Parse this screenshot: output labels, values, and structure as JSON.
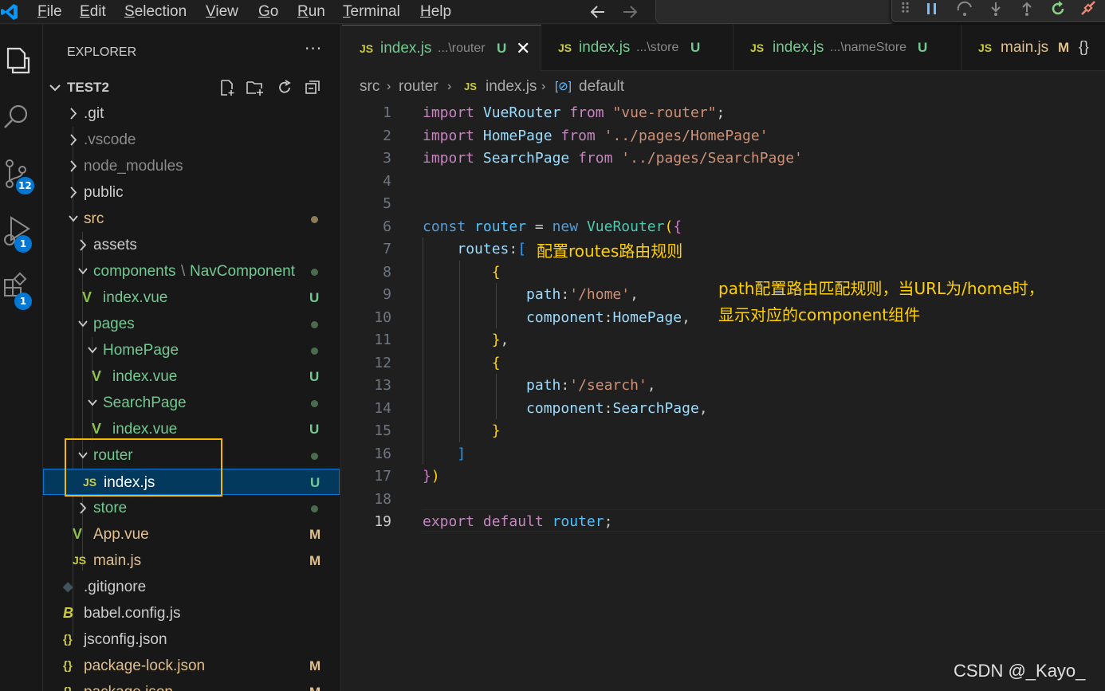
{
  "menubar": {
    "items": [
      "File",
      "Edit",
      "Selection",
      "View",
      "Go",
      "Run",
      "Terminal",
      "Help"
    ],
    "mnemonics": [
      "F",
      "E",
      "S",
      "V",
      "G",
      "R",
      "T",
      "H"
    ]
  },
  "activity_bar": {
    "source_control_badge": "12",
    "run_debug_badge": "1",
    "extensions_badge": "1"
  },
  "explorer": {
    "title": "EXPLORER",
    "more": "···",
    "workspace": "TEST2",
    "rows": [
      {
        "label": ".git",
        "status": ""
      },
      {
        "label": ".vscode",
        "status": ""
      },
      {
        "label": "node_modules",
        "status": ""
      },
      {
        "label": "public",
        "status": ""
      },
      {
        "label": "src",
        "status": "dot"
      },
      {
        "label": "assets",
        "status": ""
      },
      {
        "label": "components",
        "label2": "NavComponent",
        "status": "dot"
      },
      {
        "label": "index.vue",
        "status": "U"
      },
      {
        "label": "pages",
        "status": "dot"
      },
      {
        "label": "HomePage",
        "status": "dot"
      },
      {
        "label": "index.vue",
        "status": "U"
      },
      {
        "label": "SearchPage",
        "status": "dot"
      },
      {
        "label": "index.vue",
        "status": "U"
      },
      {
        "label": "router",
        "status": "dot"
      },
      {
        "label": "index.js",
        "status": "U"
      },
      {
        "label": "store",
        "status": "dot"
      },
      {
        "label": "App.vue",
        "status": "M"
      },
      {
        "label": "main.js",
        "status": "M"
      },
      {
        "label": ".gitignore",
        "status": ""
      },
      {
        "label": "babel.config.js",
        "status": ""
      },
      {
        "label": "jsconfig.json",
        "status": ""
      },
      {
        "label": "package-lock.json",
        "status": "M"
      },
      {
        "label": "package.json",
        "status": "M"
      }
    ],
    "separator": "\\"
  },
  "tabs": [
    {
      "name": "index.js",
      "desc": "...\\router",
      "status": "U",
      "icon": "JS"
    },
    {
      "name": "index.js",
      "desc": "...\\store",
      "status": "U",
      "icon": "JS"
    },
    {
      "name": "index.js",
      "desc": "...\\nameStore",
      "status": "U",
      "icon": "JS"
    },
    {
      "name": "main.js",
      "desc": "",
      "status": "M",
      "icon": "JS"
    }
  ],
  "breadcrumb": [
    "src",
    "router",
    "index.js",
    "default"
  ],
  "editor": {
    "line_numbers": [
      "1",
      "2",
      "3",
      "4",
      "5",
      "6",
      "7",
      "8",
      "9",
      "10",
      "11",
      "12",
      "13",
      "14",
      "15",
      "16",
      "17",
      "18",
      "19"
    ],
    "current_line": 19
  },
  "annotations": {
    "routes_note": "配置routes路由规则",
    "path_note_line1": "path配置路由匹配规则，当URL为/home时，",
    "path_note_line2": "显示对应的component组件"
  },
  "watermark": "CSDN @_Kayo_",
  "colors": {
    "accent": "#0078d4",
    "highlight_box": "#f5b800",
    "annotation_text": "#ffd000",
    "untracked": "#73c991",
    "modified": "#e2c08d"
  }
}
